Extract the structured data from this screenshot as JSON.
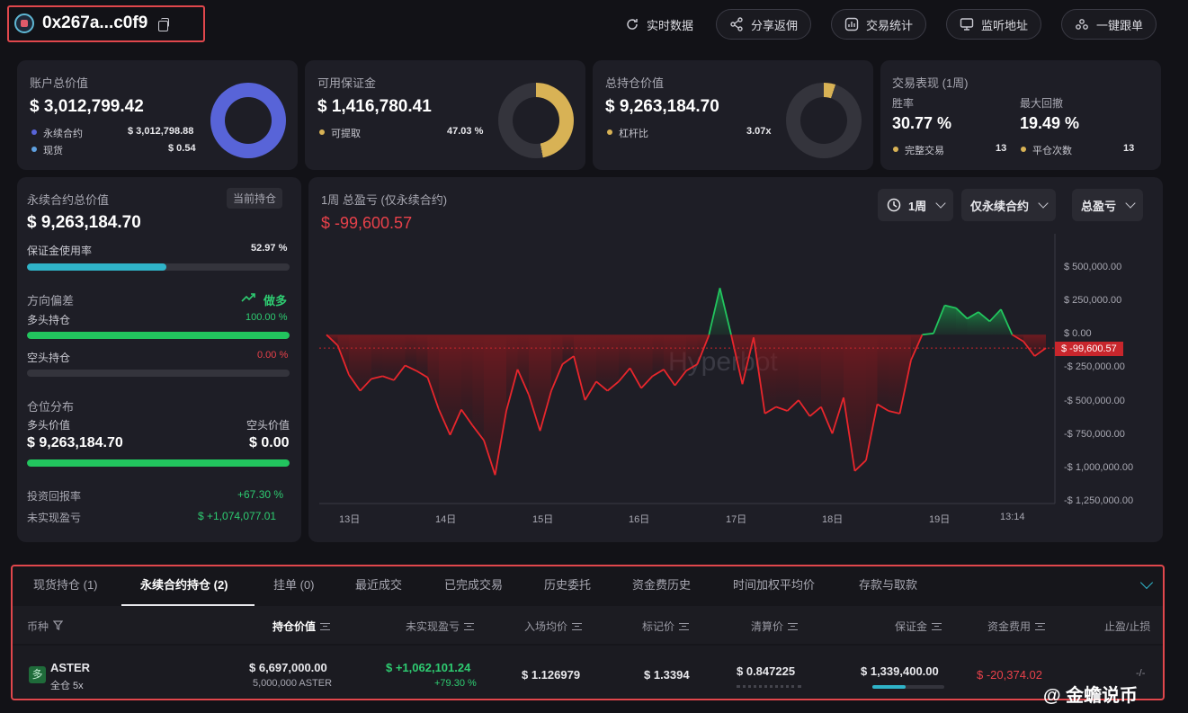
{
  "header": {
    "address": "0x267a...c0f9",
    "buttons": [
      {
        "label": "实时数据",
        "icon": "refresh-icon"
      },
      {
        "label": "分享返佣",
        "icon": "share-icon"
      },
      {
        "label": "交易统计",
        "icon": "stats-icon"
      },
      {
        "label": "监听地址",
        "icon": "monitor-icon"
      },
      {
        "label": "一键跟单",
        "icon": "copy-trade-icon"
      }
    ]
  },
  "cards": {
    "total_value": {
      "title": "账户总价值",
      "value": "$ 3,012,799.42",
      "rows": [
        {
          "label": "永续合约",
          "value": "$ 3,012,798.88"
        },
        {
          "label": "现货",
          "value": "$ 0.54"
        }
      ],
      "donut_fraction": 0.9999,
      "color": "#5864d8"
    },
    "margin": {
      "title": "可用保证金",
      "value": "$ 1,416,780.41",
      "rows": [
        {
          "label": "可提取",
          "value": "47.03 %"
        }
      ],
      "donut_fraction": 0.4703,
      "color": "#d8b255"
    },
    "position": {
      "title": "总持仓价值",
      "value": "$ 9,263,184.70",
      "rows": [
        {
          "label": "杠杆比",
          "value": "3.07x"
        }
      ],
      "donut_fraction": 0.05,
      "color": "#d8b255"
    },
    "performance": {
      "title": "交易表现 (1周)",
      "win_rate_label": "胜率",
      "win_rate": "30.77 %",
      "drawdown_label": "最大回撤",
      "drawdown": "19.49 %",
      "complete_label": "完整交易",
      "complete": "13",
      "close_label": "平仓次数",
      "close": "13"
    }
  },
  "perp": {
    "title": "永续合约总价值",
    "tag": "当前持仓",
    "value": "$ 9,263,184.70",
    "margin_usage_label": "保证金使用率",
    "margin_usage": "52.97 %",
    "margin_usage_fraction": 0.5297,
    "bias_label": "方向偏差",
    "bias_value": "做多",
    "long_label": "多头持仓",
    "long_pct": "100.00 %",
    "long_fraction": 1.0,
    "short_label": "空头持仓",
    "short_pct": "0.00 %",
    "short_fraction": 0.0,
    "dist_label": "仓位分布",
    "long_value_label": "多头价值",
    "short_value_label": "空头价值",
    "long_value": "$ 9,263,184.70",
    "short_value": "$ 0.00",
    "dist_fraction": 1.0,
    "roi_label": "投资回报率",
    "roi": "+67.30 %",
    "upnl_label": "未实现盈亏",
    "upnl": "$ +1,074,077.01"
  },
  "pnl": {
    "title": "1周 总盈亏 (仅永续合约)",
    "value": "$ -99,600.57",
    "filters": [
      "1周",
      "仅永续合约",
      "总盈亏"
    ],
    "watermark": "Hyperbot",
    "current_label": "$ -99,600.57"
  },
  "chart_data": {
    "type": "area",
    "title": "1周 总盈亏 (仅永续合约)",
    "xlabel": "",
    "ylabel": "",
    "x_ticks": [
      "13日",
      "14日",
      "15日",
      "16日",
      "17日",
      "18日",
      "19日",
      "13:14"
    ],
    "y_ticks": [
      "$ 500,000.00",
      "$ 250,000.00",
      "$ 0.00",
      "-$ 250,000.00",
      "-$ 500,000.00",
      "-$ 750,000.00",
      "-$ 1,000,000.00",
      "-$ 1,250,000.00"
    ],
    "ylim": [
      -1250000,
      500000
    ],
    "current": -99600.57,
    "values": [
      0,
      -80000,
      -300000,
      -420000,
      -330000,
      -310000,
      -340000,
      -230000,
      -270000,
      -320000,
      -560000,
      -750000,
      -560000,
      -680000,
      -790000,
      -1050000,
      -570000,
      -260000,
      -450000,
      -720000,
      -420000,
      -220000,
      -160000,
      -490000,
      -350000,
      -420000,
      -350000,
      -250000,
      -400000,
      -310000,
      -260000,
      -380000,
      -270000,
      -220000,
      -10000,
      350000,
      0,
      -370000,
      -20000,
      -590000,
      -540000,
      -570000,
      -490000,
      -610000,
      -540000,
      -740000,
      -470000,
      -1020000,
      -940000,
      -520000,
      -570000,
      -590000,
      -190000,
      0,
      10000,
      220000,
      200000,
      120000,
      170000,
      100000,
      190000,
      0,
      -50000,
      -160000,
      -100000
    ]
  },
  "table": {
    "tabs": [
      "现货持仓 (1)",
      "永续合约持仓 (2)",
      "挂单 (0)",
      "最近成交",
      "已完成交易",
      "历史委托",
      "资金费历史",
      "时间加权平均价",
      "存款与取款"
    ],
    "headers": [
      "币种",
      "持仓价值",
      "未实现盈亏",
      "入场均价",
      "标记价",
      "清算价",
      "保证金",
      "资金费用",
      "止盈/止损"
    ],
    "row": {
      "coin": "ASTER",
      "mode": "全仓 5x",
      "pos_value": "$ 6,697,000.00",
      "pos_size": "5,000,000 ASTER",
      "upnl": "$ +1,062,101.24",
      "upnl_pct": "+79.30 %",
      "entry": "$ 1.126979",
      "mark": "$ 1.3394",
      "liq": "$ 0.847225",
      "margin": "$ 1,339,400.00",
      "funding": "$ -20,374.02",
      "tpsl": "-/-"
    }
  },
  "watermark_corner": "@ 金蟾说币"
}
